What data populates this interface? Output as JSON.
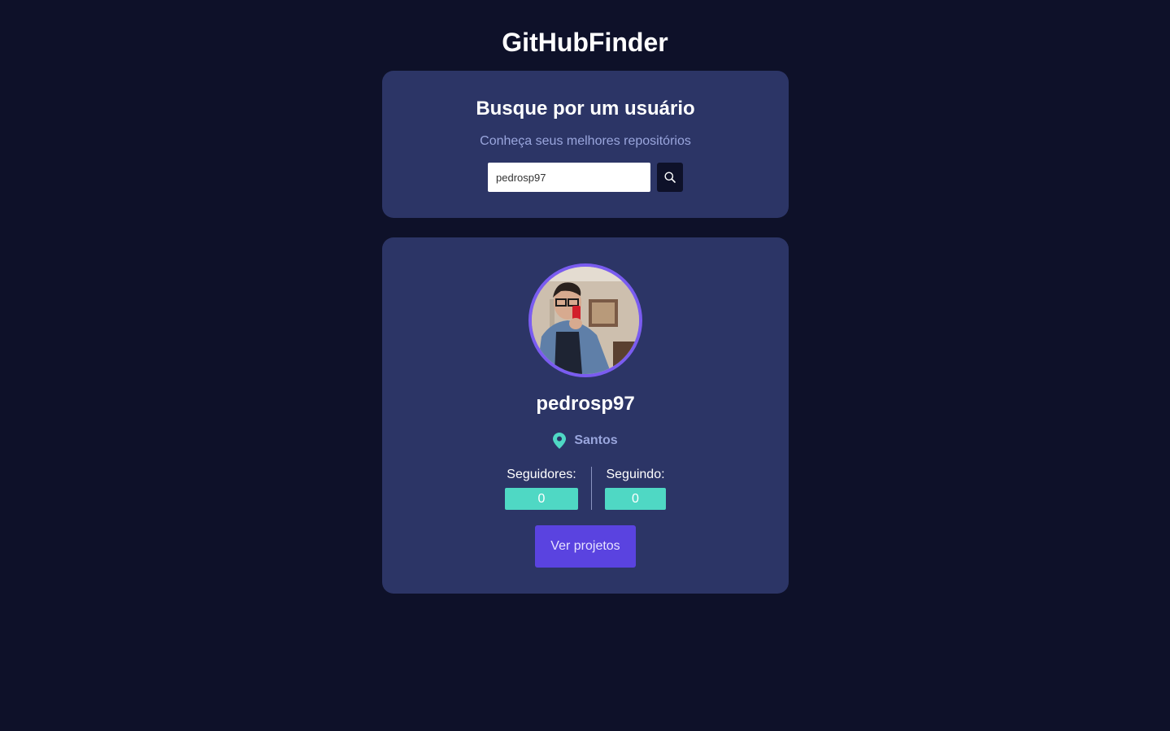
{
  "app": {
    "title": "GitHubFinder"
  },
  "search": {
    "heading": "Busque por um usuário",
    "subtitle": "Conheça seus melhores repositórios",
    "value": "pedrosp97",
    "button_icon": "search-icon"
  },
  "profile": {
    "name": "pedrosp97",
    "location": "Santos",
    "location_icon": "map-pin-icon",
    "followers_label": "Seguidores:",
    "followers_value": "0",
    "following_label": "Seguindo:",
    "following_value": "0",
    "projects_button": "Ver projetos"
  },
  "colors": {
    "background": "#0e1129",
    "card": "#2c3566",
    "accent": "#5a43e0",
    "avatar_border": "#7a5cf0",
    "teal": "#4fd8c4",
    "muted_text": "#9aa6dd"
  }
}
